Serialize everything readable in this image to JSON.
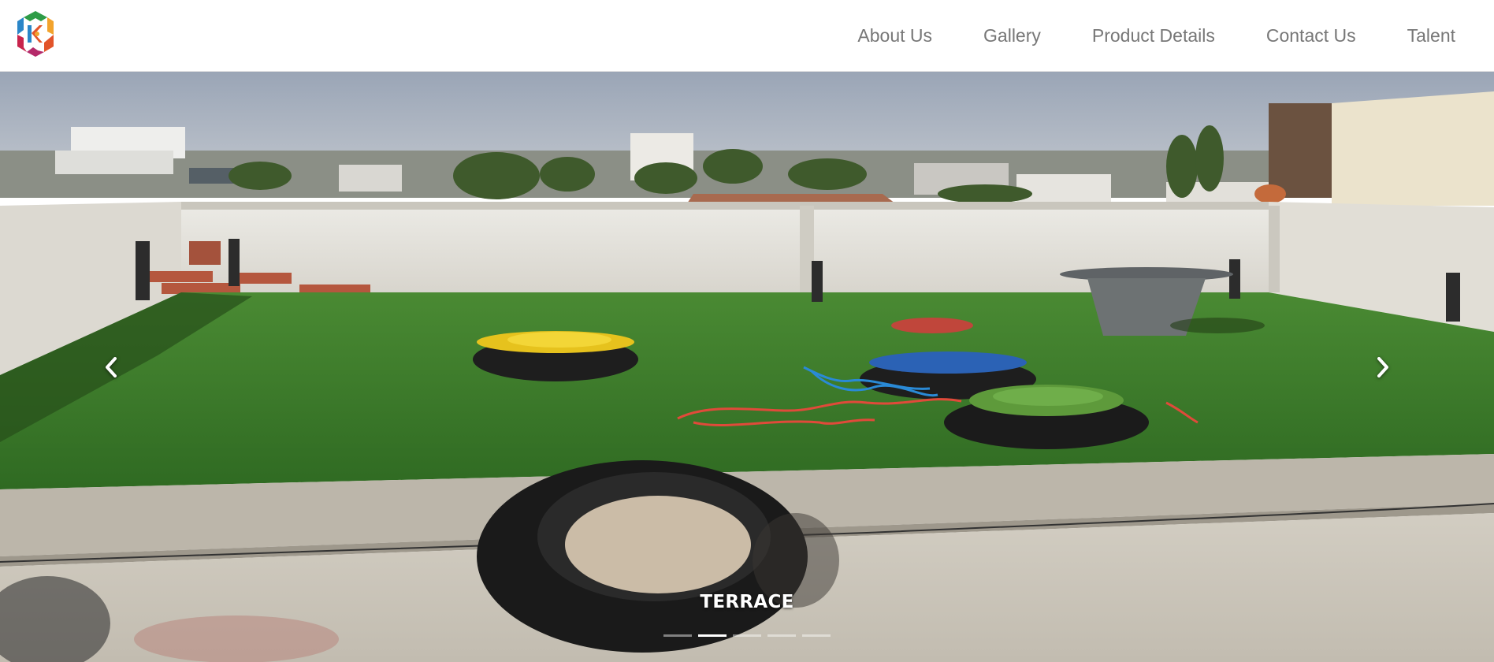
{
  "nav": {
    "logo_alt": "logo",
    "links": [
      {
        "label": "About Us"
      },
      {
        "label": "Gallery"
      },
      {
        "label": "Product Details"
      },
      {
        "label": "Contact Us"
      },
      {
        "label": "Talent"
      }
    ]
  },
  "carousel": {
    "caption": "TERRACE",
    "active_slide": 2,
    "slide_count": 5,
    "prev_icon": "chevron-left-icon",
    "next_icon": "chevron-right-icon"
  },
  "colors": {
    "nav_text": "#777777",
    "sky": "#aab3c2",
    "grass": "#3f7a2a",
    "wall": "#e4e2dc",
    "concrete": "#cbc6bb"
  }
}
